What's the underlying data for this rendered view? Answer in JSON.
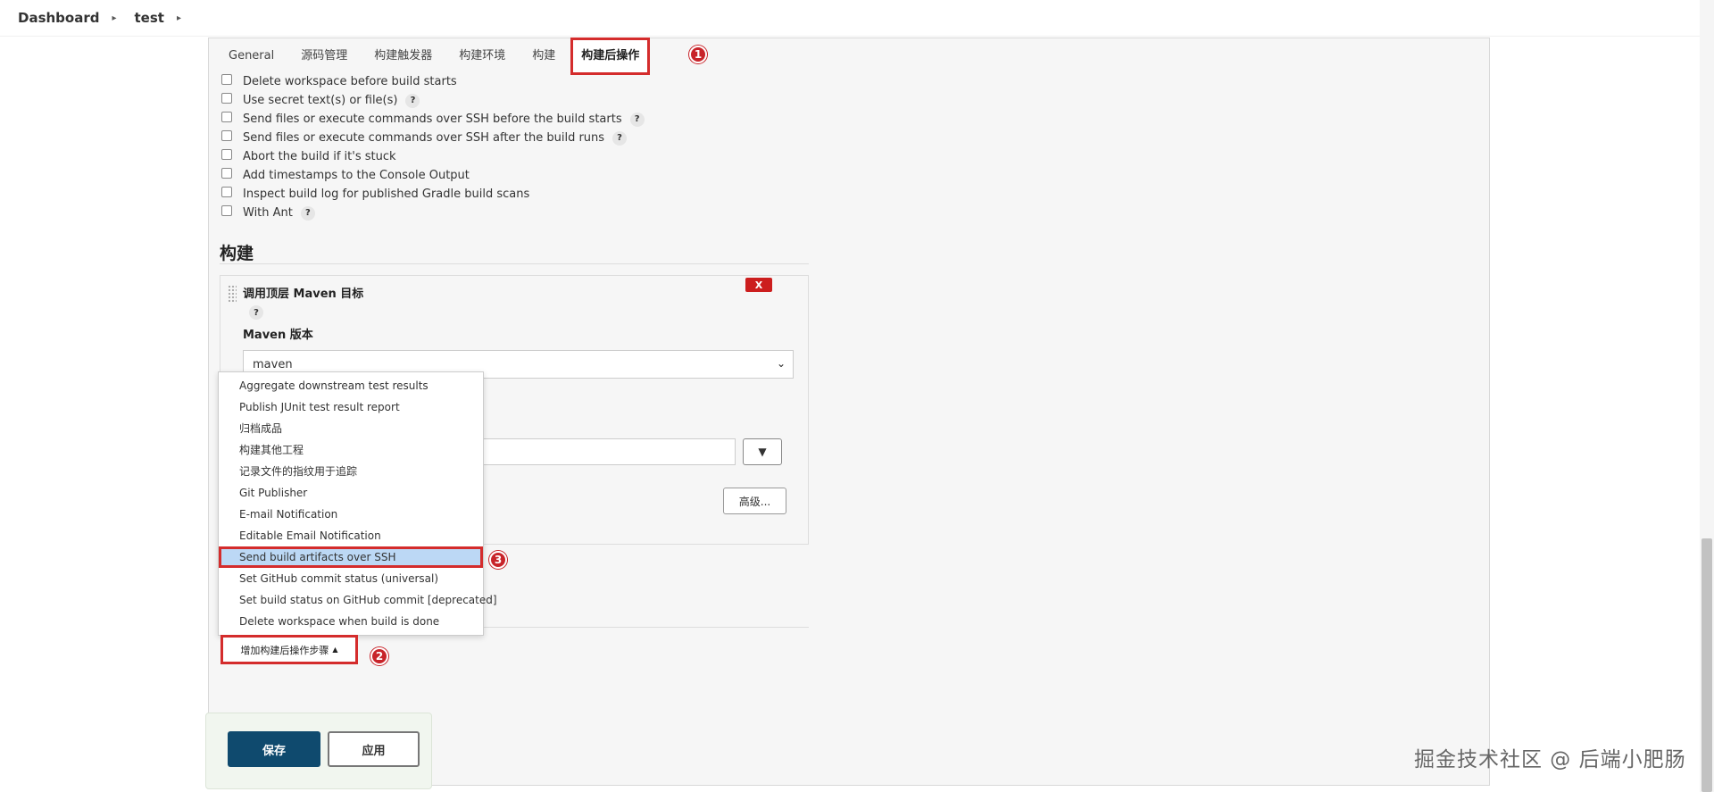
{
  "breadcrumbs": [
    "Dashboard",
    "test"
  ],
  "tabs": [
    "General",
    "源码管理",
    "构建触发器",
    "构建环境",
    "构建",
    "构建后操作"
  ],
  "markers": [
    "1",
    "2",
    "3"
  ],
  "build_env_options": [
    {
      "label": "Delete workspace before build starts",
      "help": false
    },
    {
      "label": "Use secret text(s) or file(s)",
      "help": true
    },
    {
      "label": "Send files or execute commands over SSH before the build starts",
      "help": true
    },
    {
      "label": "Send files or execute commands over SSH after the build runs",
      "help": true
    },
    {
      "label": "Abort the build if it's stuck",
      "help": false
    },
    {
      "label": "Add timestamps to the Console Output",
      "help": false
    },
    {
      "label": "Inspect build log for published Gradle build scans",
      "help": false
    },
    {
      "label": "With Ant",
      "help": true
    }
  ],
  "help_glyph": "?",
  "build_section": {
    "title": "构建",
    "step_title": "调用顶层 Maven 目标",
    "delete_label": "X",
    "maven_version_label": "Maven 版本",
    "maven_version_value": "maven",
    "expand_glyph": "▼",
    "advanced_label": "高级..."
  },
  "post_build_menu": {
    "items": [
      "Aggregate downstream test results",
      "Publish JUnit test result report",
      "归档成品",
      "构建其他工程",
      "记录文件的指纹用于追踪",
      "Git Publisher",
      "E-mail Notification",
      "Editable Email Notification",
      "Send build artifacts over SSH",
      "Set GitHub commit status (universal)",
      "Set build status on GitHub commit [deprecated]",
      "Delete workspace when build is done"
    ],
    "highlighted_index": 8
  },
  "add_post_build_label": "增加构建后操作步骤",
  "save_label": "保存",
  "apply_label": "应用",
  "watermark": "掘金技术社区 @ 后端小肥肠",
  "colors": {
    "accent_red": "#d42c2c",
    "save_blue": "#0f4a6e",
    "highlight_blue": "#bcd8f5"
  }
}
